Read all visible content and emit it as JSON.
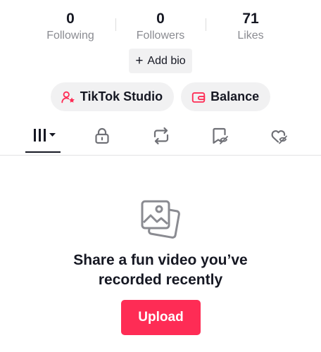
{
  "stats": [
    {
      "value": "0",
      "label": "Following"
    },
    {
      "value": "0",
      "label": "Followers"
    },
    {
      "value": "71",
      "label": "Likes"
    }
  ],
  "bio": {
    "label": "Add bio",
    "icon": "plus-icon"
  },
  "chips": {
    "studio": {
      "label": "TikTok Studio",
      "icon": "creator-person-star-icon"
    },
    "balance": {
      "label": "Balance",
      "icon": "wallet-icon"
    }
  },
  "tabs": [
    {
      "name": "videos",
      "icon": "grid-bars-dropdown-icon",
      "active": true
    },
    {
      "name": "private",
      "icon": "lock-icon",
      "active": false
    },
    {
      "name": "reposts",
      "icon": "repost-icon",
      "active": false
    },
    {
      "name": "favorites",
      "icon": "bookmark-hidden-icon",
      "active": false
    },
    {
      "name": "liked",
      "icon": "heart-hidden-icon",
      "active": false
    }
  ],
  "empty_state": {
    "icon": "photos-icon",
    "line1": "Share a fun video you’ve",
    "line2": "recorded recently"
  },
  "upload": {
    "label": "Upload"
  },
  "colors": {
    "accent": "#fe2c55",
    "text": "#161823",
    "muted": "#8a8b91",
    "chip_bg": "#f1f1f2"
  }
}
